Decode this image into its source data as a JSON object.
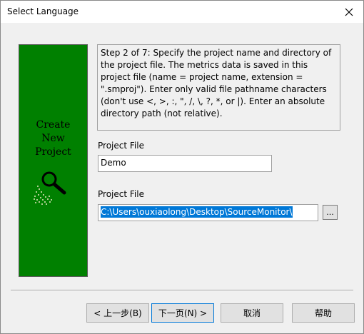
{
  "window": {
    "title": "Select Language",
    "close_icon": "close-icon"
  },
  "side_panel": {
    "lines": [
      "Create",
      "New",
      "Project"
    ],
    "icon": "magnifier-icon",
    "background": "#008000"
  },
  "description": "Step 2 of 7: Specify the project name and directory of the project file. The metrics data is saved in this project file (name = project name, extension = \".smproj\"). Enter only valid file pathname characters (don't use <, >, :, \", /, \\, ?, *, or |). Enter an absolute directory path (not relative).",
  "project_name": {
    "label": "Project File",
    "value": "Demo"
  },
  "project_dir": {
    "label": "Project File",
    "value": "C:\\Users\\ouxiaolong\\Desktop\\SourceMonitor\\",
    "browse_label": "...",
    "selection_color": "#0078d7"
  },
  "buttons": {
    "back": "< 上一步(B)",
    "next": "下一页(N) >",
    "cancel": "取消",
    "help": "帮助"
  }
}
